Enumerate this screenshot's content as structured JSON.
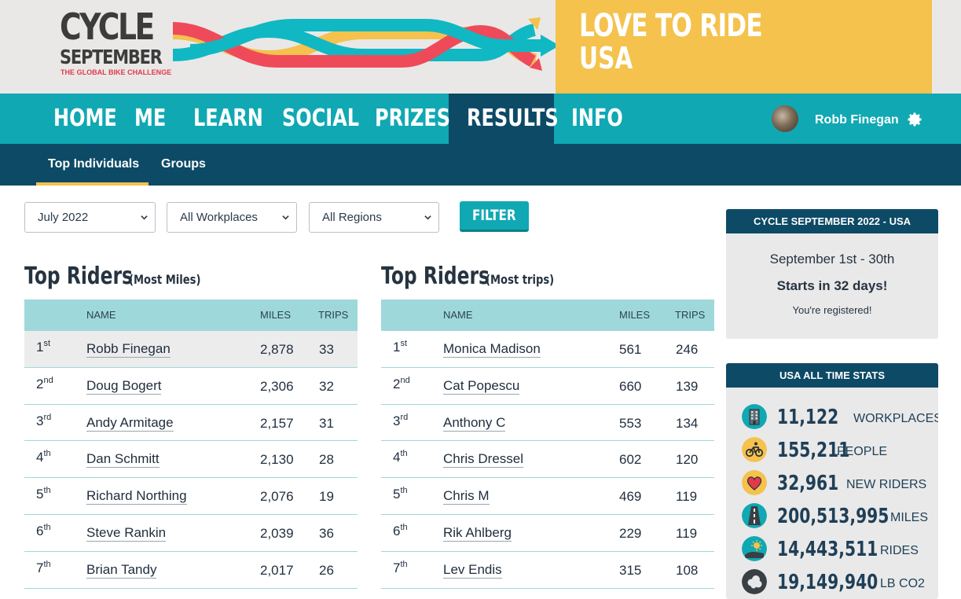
{
  "banner": {
    "logo_line1": "CYCLE",
    "logo_line2": "SEPTEMBER",
    "logo_tagline": "THE GLOBAL BIKE CHALLENGE",
    "brand_line1": "LOVE TO RIDE",
    "brand_line2": "USA"
  },
  "nav": {
    "items": [
      "HOME",
      "ME",
      "LEARN",
      "SOCIAL",
      "PRIZES",
      "RESULTS",
      "INFO"
    ],
    "active": "RESULTS",
    "user_name": "Robb Finegan"
  },
  "subnav": {
    "items": [
      "Top Individuals",
      "Groups"
    ],
    "active": "Top Individuals"
  },
  "filters": {
    "month": "July 2022",
    "workplace": "All Workplaces",
    "region": "All Regions",
    "button": "FILTER"
  },
  "tables": {
    "headers": {
      "name": "NAME",
      "miles": "MILES",
      "trips": "TRIPS"
    },
    "most_miles": {
      "title": "Top Riders",
      "subtitle": "(Most Miles)",
      "rows": [
        {
          "rank": "1",
          "suffix": "st",
          "name": "Robb Finegan",
          "miles": "2,878",
          "trips": "33"
        },
        {
          "rank": "2",
          "suffix": "nd",
          "name": "Doug Bogert",
          "miles": "2,306",
          "trips": "32"
        },
        {
          "rank": "3",
          "suffix": "rd",
          "name": "Andy Armitage",
          "miles": "2,157",
          "trips": "31"
        },
        {
          "rank": "4",
          "suffix": "th",
          "name": "Dan Schmitt",
          "miles": "2,130",
          "trips": "28"
        },
        {
          "rank": "5",
          "suffix": "th",
          "name": "Richard Northing",
          "miles": "2,076",
          "trips": "19"
        },
        {
          "rank": "6",
          "suffix": "th",
          "name": "Steve Rankin",
          "miles": "2,039",
          "trips": "36"
        },
        {
          "rank": "7",
          "suffix": "th",
          "name": "Brian Tandy",
          "miles": "2,017",
          "trips": "26"
        }
      ]
    },
    "most_trips": {
      "title": "Top Riders",
      "subtitle": "(Most trips)",
      "rows": [
        {
          "rank": "1",
          "suffix": "st",
          "name": "Monica Madison",
          "miles": "561",
          "trips": "246"
        },
        {
          "rank": "2",
          "suffix": "nd",
          "name": "Cat Popescu",
          "miles": "660",
          "trips": "139"
        },
        {
          "rank": "3",
          "suffix": "rd",
          "name": "Anthony C",
          "miles": "553",
          "trips": "134"
        },
        {
          "rank": "4",
          "suffix": "th",
          "name": "Chris Dressel",
          "miles": "602",
          "trips": "120"
        },
        {
          "rank": "5",
          "suffix": "th",
          "name": "Chris M",
          "miles": "469",
          "trips": "119"
        },
        {
          "rank": "6",
          "suffix": "th",
          "name": "Rik Ahlberg",
          "miles": "229",
          "trips": "119"
        },
        {
          "rank": "7",
          "suffix": "th",
          "name": "Lev Endis",
          "miles": "315",
          "trips": "108"
        }
      ]
    }
  },
  "event_panel": {
    "title": "CYCLE SEPTEMBER 2022 - USA",
    "dates": "September 1st - 30th",
    "countdown": "Starts in 32 days!",
    "status": "You're registered!"
  },
  "stats_panel": {
    "title": "USA ALL TIME STATS",
    "stats": [
      {
        "value": "11,122",
        "label": "WORKPLACES",
        "icon": "building-icon"
      },
      {
        "value": "155,211",
        "label": "PEOPLE",
        "icon": "cyclist-icon"
      },
      {
        "value": "32,961",
        "label": "NEW RIDERS",
        "icon": "heart-icon"
      },
      {
        "value": "200,513,995",
        "label": "MILES",
        "icon": "road-icon"
      },
      {
        "value": "14,443,511",
        "label": "RIDES",
        "icon": "sun-icon"
      },
      {
        "value": "19,149,940",
        "label": "LB CO2",
        "icon": "cloud-icon"
      }
    ]
  },
  "colors": {
    "teal": "#10a8b3",
    "navy": "#0d4a66",
    "yellow": "#f4c24d",
    "red": "#ef4a5a",
    "light_teal": "#9fd8da"
  }
}
